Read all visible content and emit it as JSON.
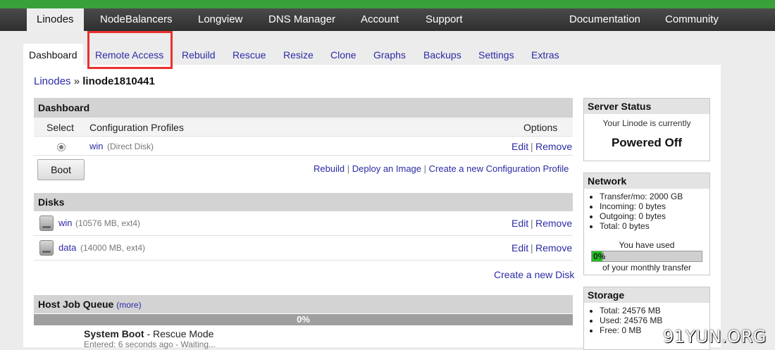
{
  "topnav": {
    "items": [
      "Linodes",
      "NodeBalancers",
      "Longview",
      "DNS Manager",
      "Account",
      "Support",
      "Documentation",
      "Community"
    ]
  },
  "subtabs": {
    "items": [
      "Dashboard",
      "Remote Access",
      "Rebuild",
      "Rescue",
      "Resize",
      "Clone",
      "Graphs",
      "Backups",
      "Settings",
      "Extras"
    ]
  },
  "breadcrumb": {
    "root": "Linodes",
    "sep": "»",
    "current": "linode1810441"
  },
  "dashboard": {
    "title": "Dashboard",
    "col_select": "Select",
    "col_profiles": "Configuration Profiles",
    "col_options": "Options",
    "profile_name": "win",
    "profile_detail": "(Direct Disk)",
    "edit": "Edit",
    "pipe": "|",
    "remove": "Remove",
    "boot_button": "Boot",
    "rebuild": "Rebuild",
    "deploy": "Deploy an Image",
    "create_profile": "Create a new Configuration Profile"
  },
  "disks": {
    "title": "Disks",
    "items": [
      {
        "name": "win",
        "detail": "(10576 MB, ext4)"
      },
      {
        "name": "data",
        "detail": "(14000 MB, ext4)"
      }
    ],
    "edit": "Edit",
    "pipe": "|",
    "remove": "Remove",
    "create_disk": "Create a new Disk"
  },
  "jobqueue": {
    "title": "Host Job Queue",
    "more": "(more)",
    "progress_label": "0%",
    "progress": 0,
    "job_title": "System Boot",
    "job_suffix": " - Rescue Mode",
    "job_status": "Entered: 6 seconds ago - Waiting..."
  },
  "server_status": {
    "title": "Server Status",
    "line1": "Your Linode is currently",
    "state": "Powered Off"
  },
  "network": {
    "title": "Network",
    "items": [
      "Transfer/mo: 2000 GB",
      "Incoming: 0 bytes",
      "Outgoing: 0 bytes",
      "Total: 0 bytes"
    ],
    "used_label": "You have used",
    "used_percent_label": "0%",
    "used_fraction": 0,
    "monthly": "of your monthly transfer"
  },
  "storage": {
    "title": "Storage",
    "items": [
      "Total: 24576 MB",
      "Used: 24576 MB",
      "Free: 0 MB"
    ]
  },
  "watermark": "91YUN.ORG",
  "colors": {
    "accent_green": "#3aa13a",
    "link": "#2b2ba6",
    "highlight": "#e8312e"
  }
}
